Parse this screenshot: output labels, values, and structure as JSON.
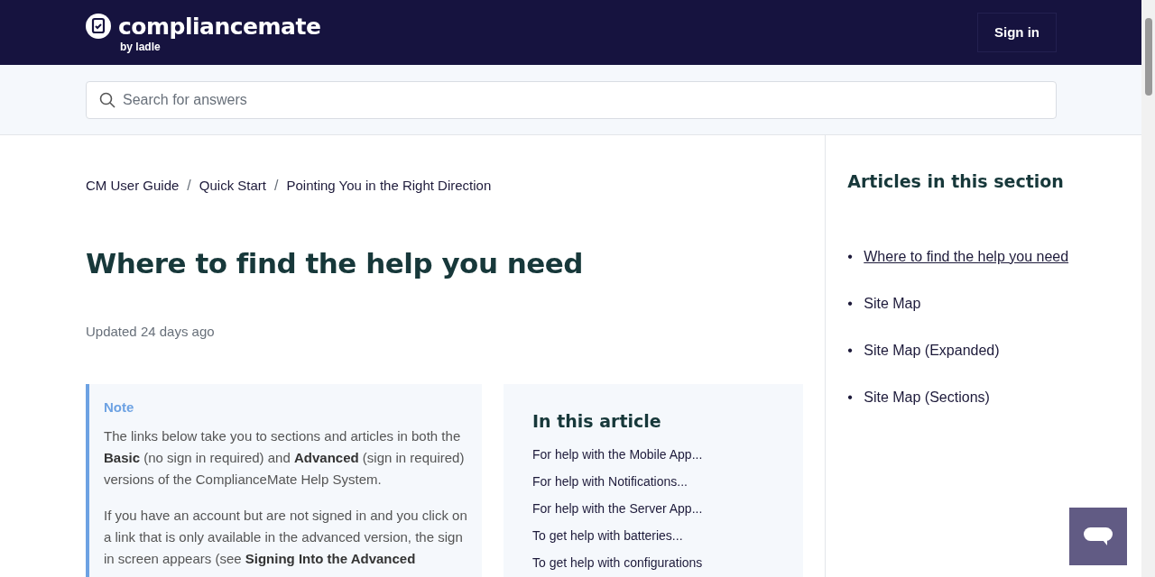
{
  "header": {
    "logo_text": "compliancemate",
    "logo_sub": "by ladle",
    "sign_in": "Sign in"
  },
  "search": {
    "placeholder": "Search for answers"
  },
  "breadcrumbs": [
    {
      "label": "CM User Guide"
    },
    {
      "separator": "/",
      "label": "Quick Start"
    },
    {
      "separator": "/",
      "label": "Pointing You in the Right Direction"
    }
  ],
  "article": {
    "title": "Where to find the help you need",
    "updated": "Updated 24 days ago",
    "note": {
      "title": "Note",
      "paragraphs": [
        "The links below take you to sections and articles in both the **Basic** (no sign in required) and **Advanced** (sign in required) versions of the ComplianceMate Help System.",
        "If you have an account but are not signed in and you click on a link that is only available in the advanced version, the sign in screen appears (see **Signing Into the Advanced**"
      ]
    },
    "toc": {
      "title": "In this article",
      "items": [
        "For help with the Mobile App...",
        "For help with Notifications...",
        "For help with the Server App...",
        "To get help with batteries...",
        "To get help with configurations"
      ]
    }
  },
  "sidebar": {
    "title": "Articles in this section",
    "items": [
      {
        "bullet": "•",
        "label": "Where to find the help you need",
        "selected": true
      },
      {
        "bullet": "•",
        "label": "Site Map",
        "selected": false
      },
      {
        "bullet": "•",
        "label": "Site Map (Expanded)",
        "selected": false
      },
      {
        "bullet": "•",
        "label": "Site Map (Sections)",
        "selected": false
      }
    ]
  }
}
